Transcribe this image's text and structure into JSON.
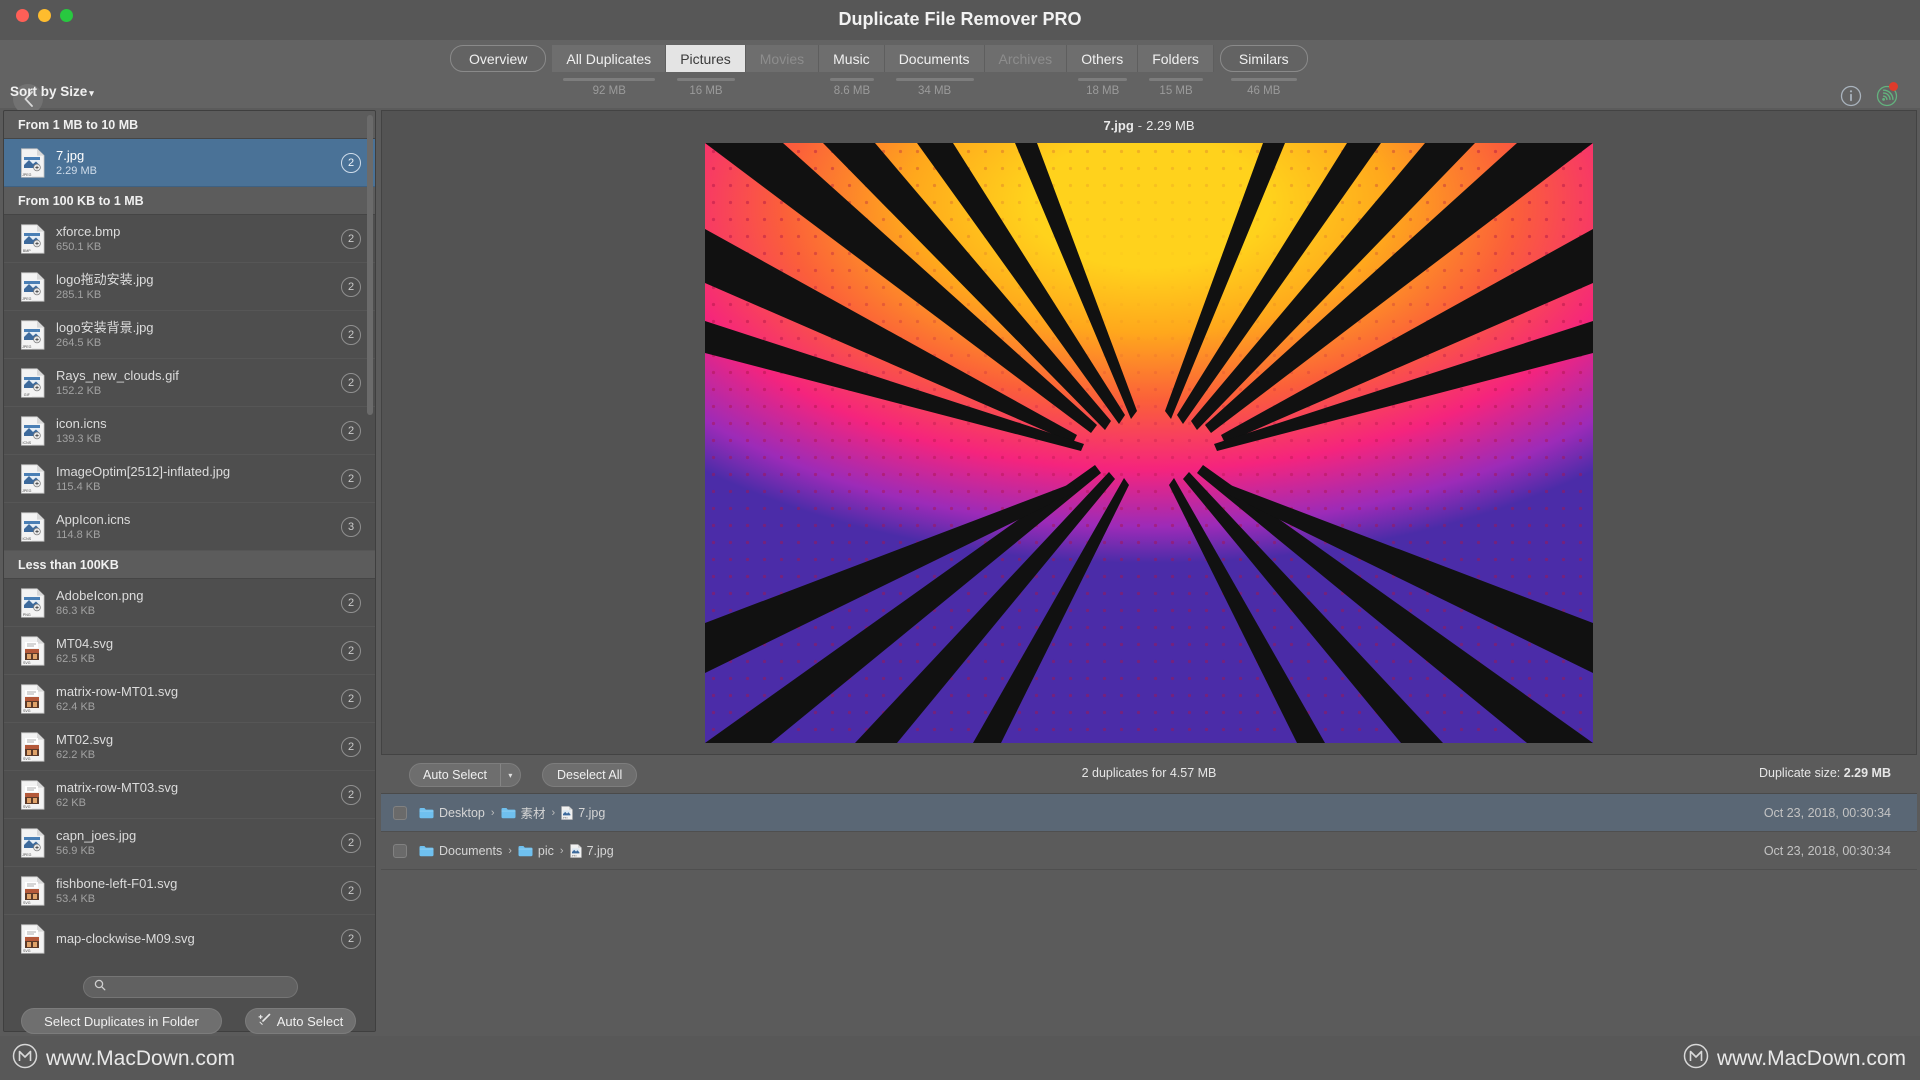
{
  "window": {
    "title": "Duplicate File Remover PRO",
    "traffic_lights": [
      "close",
      "minimize",
      "zoom"
    ]
  },
  "toolbar": {
    "back_icon": "chevron-left-icon",
    "info_icon": "info-circle-icon",
    "broadcast_icon": "broadcast-icon",
    "tabs": [
      {
        "label": "Overview",
        "size": "",
        "style": "pill",
        "state": "normal"
      },
      {
        "label": "All Duplicates",
        "size": "92 MB",
        "style": "segment",
        "state": "normal"
      },
      {
        "label": "Pictures",
        "size": "16 MB",
        "style": "segment",
        "state": "active"
      },
      {
        "label": "Movies",
        "size": "",
        "style": "segment",
        "state": "disabled"
      },
      {
        "label": "Music",
        "size": "8.6 MB",
        "style": "segment",
        "state": "normal"
      },
      {
        "label": "Documents",
        "size": "34 MB",
        "style": "segment",
        "state": "normal"
      },
      {
        "label": "Archives",
        "size": "",
        "style": "segment",
        "state": "disabled"
      },
      {
        "label": "Others",
        "size": "18 MB",
        "style": "segment",
        "state": "normal"
      },
      {
        "label": "Folders",
        "size": "15 MB",
        "style": "segment",
        "state": "normal"
      },
      {
        "label": "Similars",
        "size": "46 MB",
        "style": "pill",
        "state": "normal"
      }
    ]
  },
  "sidebar": {
    "sort_label": "Sort by Size",
    "sort_caret": "▾",
    "search": {
      "placeholder": "",
      "value": "",
      "icon": "search-icon"
    },
    "groups": [
      {
        "header": "From 1 MB to 10 MB",
        "files": [
          {
            "name": "7.jpg",
            "size": "2.29 MB",
            "count": "2",
            "kind": "JPEG",
            "selected": true
          }
        ]
      },
      {
        "header": "From 100 KB to 1 MB",
        "files": [
          {
            "name": "xforce.bmp",
            "size": "650.1 KB",
            "count": "2",
            "kind": "BMP",
            "selected": false
          },
          {
            "name": "logo拖动安装.jpg",
            "size": "285.1 KB",
            "count": "2",
            "kind": "JPEG",
            "selected": false
          },
          {
            "name": "logo安装背景.jpg",
            "size": "264.5 KB",
            "count": "2",
            "kind": "JPEG",
            "selected": false
          },
          {
            "name": "Rays_new_clouds.gif",
            "size": "152.2 KB",
            "count": "2",
            "kind": "GIF",
            "selected": false
          },
          {
            "name": "icon.icns",
            "size": "139.3 KB",
            "count": "2",
            "kind": "ICNS",
            "selected": false
          },
          {
            "name": "ImageOptim[2512]-inflated.jpg",
            "size": "115.4 KB",
            "count": "2",
            "kind": "JPEG",
            "selected": false
          },
          {
            "name": "AppIcon.icns",
            "size": "114.8 KB",
            "count": "3",
            "kind": "ICNS",
            "selected": false
          }
        ]
      },
      {
        "header": "Less than 100KB",
        "files": [
          {
            "name": "AdobeIcon.png",
            "size": "86.3 KB",
            "count": "2",
            "kind": "PNG",
            "selected": false
          },
          {
            "name": "MT04.svg",
            "size": "62.5 KB",
            "count": "2",
            "kind": "SVG",
            "selected": false
          },
          {
            "name": "matrix-row-MT01.svg",
            "size": "62.4 KB",
            "count": "2",
            "kind": "SVG",
            "selected": false
          },
          {
            "name": "MT02.svg",
            "size": "62.2 KB",
            "count": "2",
            "kind": "SVG",
            "selected": false
          },
          {
            "name": "matrix-row-MT03.svg",
            "size": "62 KB",
            "count": "2",
            "kind": "SVG",
            "selected": false
          },
          {
            "name": "capn_joes.jpg",
            "size": "56.9 KB",
            "count": "2",
            "kind": "JPEG",
            "selected": false
          },
          {
            "name": "fishbone-left-F01.svg",
            "size": "53.4 KB",
            "count": "2",
            "kind": "SVG",
            "selected": false
          },
          {
            "name": "map-clockwise-M09.svg",
            "size": "",
            "count": "2",
            "kind": "SVG",
            "selected": false
          }
        ]
      }
    ],
    "buttons": {
      "select_duplicates_in_folder": "Select Duplicates in Folder",
      "auto_select": "Auto Select",
      "auto_select_icon": "magic-wand-icon"
    }
  },
  "preview": {
    "filename": "7.jpg",
    "separator": "-",
    "filesize": "2.29 MB",
    "image_alt": "comic-halftone-burst-image"
  },
  "details": {
    "auto_select_label": "Auto Select",
    "auto_select_arrow": "▾",
    "deselect_all_label": "Deselect All",
    "summary": "2 duplicates for 4.57 MB",
    "duplicate_size_prefix": "Duplicate size: ",
    "duplicate_size_value": "2.29 MB",
    "rows": [
      {
        "checked": false,
        "selected": true,
        "path": [
          {
            "label": "Desktop",
            "icon": "folder-icon"
          },
          {
            "label": "素材",
            "icon": "folder-icon"
          },
          {
            "label": "7.jpg",
            "icon": "jpeg-file-icon"
          }
        ],
        "date": "Oct 23, 2018, 00:30:34"
      },
      {
        "checked": false,
        "selected": false,
        "path": [
          {
            "label": "Documents",
            "icon": "folder-icon"
          },
          {
            "label": "pic",
            "icon": "folder-icon"
          },
          {
            "label": "7.jpg",
            "icon": "jpeg-file-icon"
          }
        ],
        "date": "Oct 23, 2018, 00:30:34"
      }
    ]
  },
  "footer": {
    "left_text": "www.MacDown.com",
    "right_text": "www.MacDown.com",
    "logo_icon": "macdown-logo-icon"
  },
  "colors": {
    "window_bg": "#5b5b5b",
    "titlebar": "#575757",
    "toolbar": "#636363",
    "sidebar": "#4e4e4e",
    "selection_blue": "#4a7297",
    "row_selection": "#5a6775",
    "active_tab_bg": "#e4e4e4",
    "folder_blue": "#6fc0ef",
    "notification_red": "#e03b2b"
  }
}
